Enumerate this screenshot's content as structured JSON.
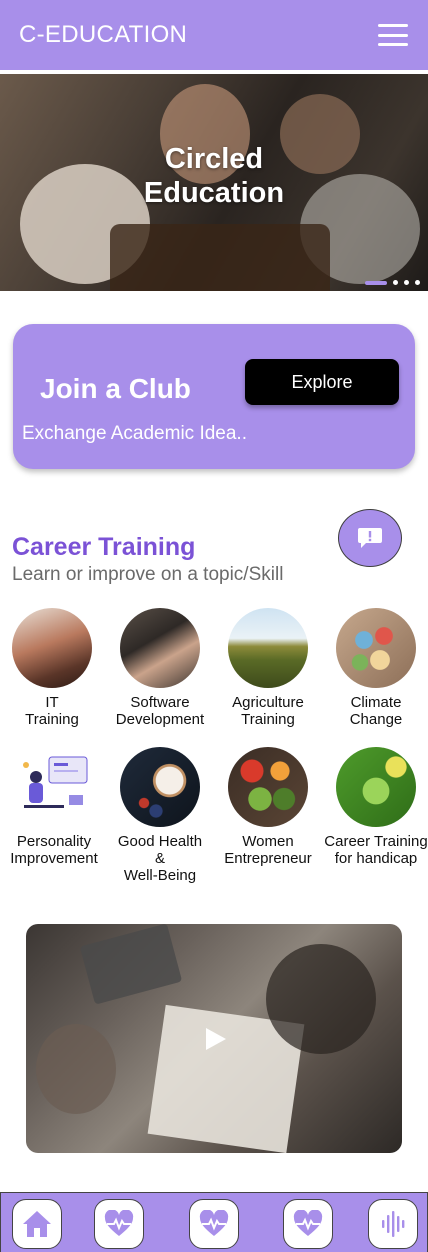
{
  "header": {
    "title": "C-EDUCATION",
    "menu_icon": "hamburger-menu-icon"
  },
  "hero": {
    "title_line1": "Circled",
    "title_line2": "Education",
    "slides": 4,
    "active_slide": 1
  },
  "club": {
    "title": "Join a Club",
    "subtitle": "Exchange Academic Idea..",
    "button": "Explore"
  },
  "career": {
    "title": "Career Training",
    "subtitle": "Learn or improve on a topic/Skill",
    "chat_icon": "chat-alert-icon"
  },
  "courses": [
    {
      "line1": "IT",
      "line2": "Training",
      "line3": ""
    },
    {
      "line1": "Software",
      "line2": "Development",
      "line3": ""
    },
    {
      "line1": "Agriculture",
      "line2": "Training",
      "line3": ""
    },
    {
      "line1": "Climate",
      "line2": "Change",
      "line3": ""
    },
    {
      "line1": "Personality",
      "line2": "Improvement",
      "line3": ""
    },
    {
      "line1": "Good Health",
      "line2": "&",
      "line3": "Well-Being"
    },
    {
      "line1": "Women",
      "line2": "Entrepreneur",
      "line3": ""
    },
    {
      "line1": "Career Training",
      "line2": "for handicap",
      "line3": ""
    }
  ],
  "video": {
    "play_icon": "play-icon"
  },
  "nav": {
    "items": [
      "home-icon",
      "heart-pulse-icon",
      "heart-pulse-icon",
      "heart-pulse-icon",
      "audio-wave-icon"
    ]
  },
  "colors": {
    "accent": "#a88fea",
    "title_purple": "#7b52d6"
  }
}
